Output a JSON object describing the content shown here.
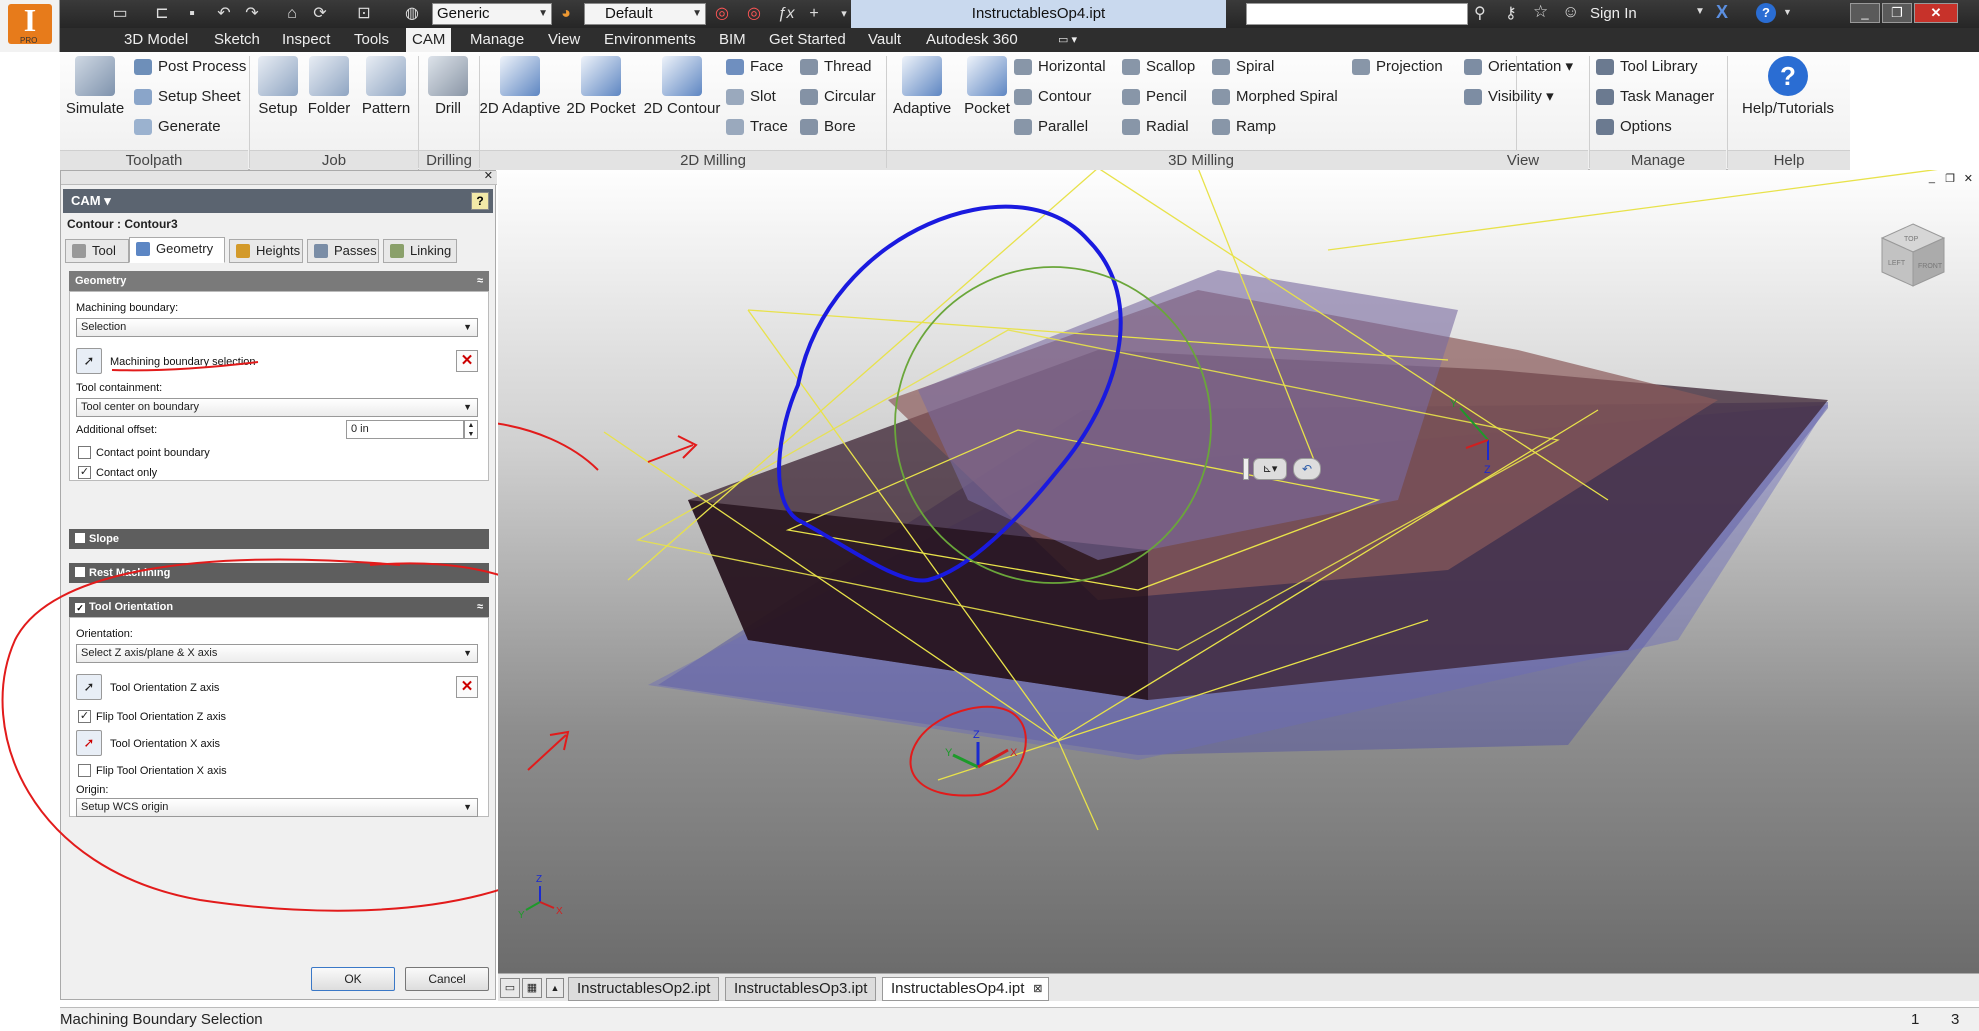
{
  "app": {
    "logo_letter": "I",
    "logo_badge": "PRO",
    "document_title": "InstructablesOp4.ipt",
    "sign_in": "Sign In",
    "material_combo": "Generic",
    "appearance_combo": "Default"
  },
  "menu_tabs": [
    "3D Model",
    "Sketch",
    "Inspect",
    "Tools",
    "CAM",
    "Manage",
    "View",
    "Environments",
    "BIM",
    "Get Started",
    "Vault",
    "Autodesk 360"
  ],
  "ribbon": {
    "toolpath": {
      "label": "Toolpath",
      "simulate": "Simulate",
      "post_process": "Post Process",
      "setup_sheet": "Setup Sheet",
      "generate": "Generate"
    },
    "job": {
      "label": "Job",
      "setup": "Setup",
      "folder": "Folder",
      "pattern": "Pattern"
    },
    "drilling": {
      "label": "Drilling",
      "drill": "Drill"
    },
    "milling2d": {
      "label": "2D Milling",
      "adaptive": "2D Adaptive",
      "pocket": "2D Pocket",
      "contour": "2D Contour",
      "face": "Face",
      "slot": "Slot",
      "trace": "Trace",
      "thread": "Thread",
      "circular": "Circular",
      "bore": "Bore"
    },
    "milling3d": {
      "label": "3D Milling",
      "adaptive": "Adaptive",
      "pocket": "Pocket",
      "horizontal": "Horizontal",
      "contour": "Contour",
      "parallel": "Parallel",
      "scallop": "Scallop",
      "pencil": "Pencil",
      "radial": "Radial",
      "spiral": "Spiral",
      "morphed_spiral": "Morphed Spiral",
      "ramp": "Ramp",
      "projection": "Projection"
    },
    "view": {
      "label": "View",
      "orientation": "Orientation",
      "visibility": "Visibility"
    },
    "manage": {
      "label": "Manage",
      "tool_library": "Tool Library",
      "task_manager": "Task Manager",
      "options": "Options"
    },
    "help": {
      "label": "Help",
      "help_tutorials": "Help/Tutorials"
    }
  },
  "panel": {
    "header": "CAM",
    "operation": "Contour : Contour3",
    "tabs": [
      "Tool",
      "Geometry",
      "Heights",
      "Passes",
      "Linking"
    ],
    "geometry": {
      "title": "Geometry",
      "machining_boundary_label": "Machining boundary:",
      "machining_boundary_value": "Selection",
      "boundary_selection": "Machining boundary selection",
      "tool_containment_label": "Tool containment:",
      "tool_containment_value": "Tool center on boundary",
      "additional_offset_label": "Additional offset:",
      "additional_offset_value": "0 in",
      "contact_point_boundary": "Contact point boundary",
      "contact_only": "Contact only"
    },
    "slope": "Slope",
    "rest_machining": "Rest Machining",
    "tool_orientation": {
      "title": "Tool Orientation",
      "orientation_label": "Orientation:",
      "orientation_value": "Select Z axis/plane & X axis",
      "z_axis": "Tool Orientation Z axis",
      "flip_z": "Flip Tool Orientation Z axis",
      "x_axis": "Tool Orientation X axis",
      "flip_x": "Flip Tool Orientation X axis",
      "origin_label": "Origin:",
      "origin_value": "Setup WCS origin"
    },
    "ok": "OK",
    "cancel": "Cancel"
  },
  "doc_tabs": [
    "InstructablesOp2.ipt",
    "InstructablesOp3.ipt",
    "InstructablesOp4.ipt"
  ],
  "status": {
    "message": "Machining Boundary Selection",
    "n1": "1",
    "n2": "3"
  },
  "viewcube": {
    "top": "TOP",
    "front": "FRONT",
    "left": "LEFT"
  },
  "axes": {
    "x": "X",
    "y": "Y",
    "z": "Z"
  },
  "colors": {
    "annotation_red": "#e21b1b",
    "boundary_blue": "#1a1adf",
    "tool_circle_green": "#6aa63a",
    "wire_yellow": "#e8e24a"
  }
}
